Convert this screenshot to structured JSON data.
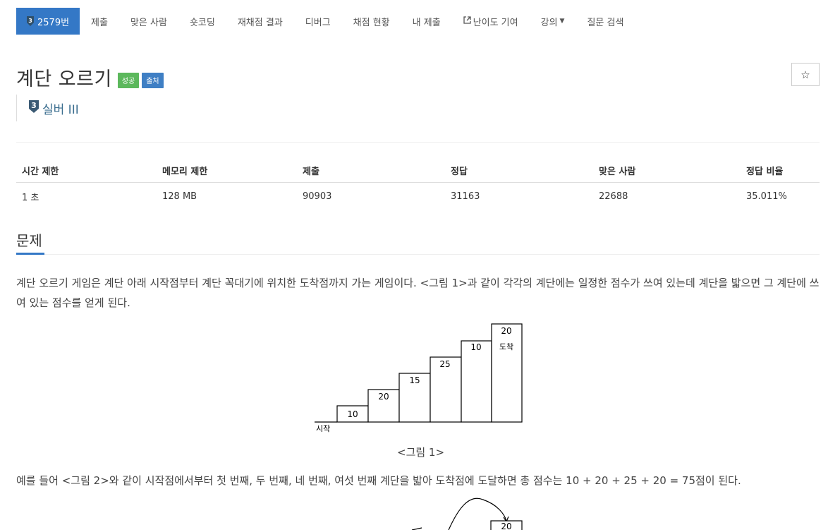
{
  "nav": {
    "problem_tier_badge": "3",
    "problem_number": "2579번",
    "items": [
      "제출",
      "맞은 사람",
      "숏코딩",
      "재채점 결과",
      "디버그",
      "채점 현황",
      "내 제출"
    ],
    "contribute_label": "난이도 기여",
    "lecture_label": "강의",
    "search_label": "질문 검색"
  },
  "problem": {
    "title": "계단 오르기",
    "badge_success": "성공",
    "badge_source": "출처",
    "star_icon": "☆",
    "tier_number": "3",
    "tier_label": "실버 III"
  },
  "stats": {
    "headers": [
      "시간 제한",
      "메모리 제한",
      "제출",
      "정답",
      "맞은 사람",
      "정답 비율"
    ],
    "values": [
      "1 초",
      "128 MB",
      "90903",
      "31163",
      "22688",
      "35.011%"
    ]
  },
  "section": {
    "title": "문제",
    "paragraph1": "계단 오르기 게임은 계단 아래 시작점부터 계단 꼭대기에 위치한 도착점까지 가는 게임이다. <그림 1>과 같이 각각의 계단에는 일정한 점수가 쓰여 있는데 계단을 밟으면 그 계단에 쓰여 있는 점수를 얻게 된다.",
    "figure1_caption": "<그림 1>",
    "paragraph2": "예를 들어 <그림 2>와 같이 시작점에서부터 첫 번째, 두 번째, 네 번째, 여섯 번째 계단을 밟아 도착점에 도달하면 총 점수는 10 + 20 + 25 + 20 = 75점이 된다."
  },
  "figure1": {
    "start_label": "시작",
    "end_label": "도착",
    "step_scores": [
      "10",
      "20",
      "15",
      "25",
      "10",
      "20"
    ]
  },
  "figure2": {
    "top_score": "20"
  },
  "colors": {
    "nav_active": "#3478c6",
    "success": "#5cb85c",
    "source": "#3f7fc4",
    "tier_silver": "#3b6e8f"
  }
}
